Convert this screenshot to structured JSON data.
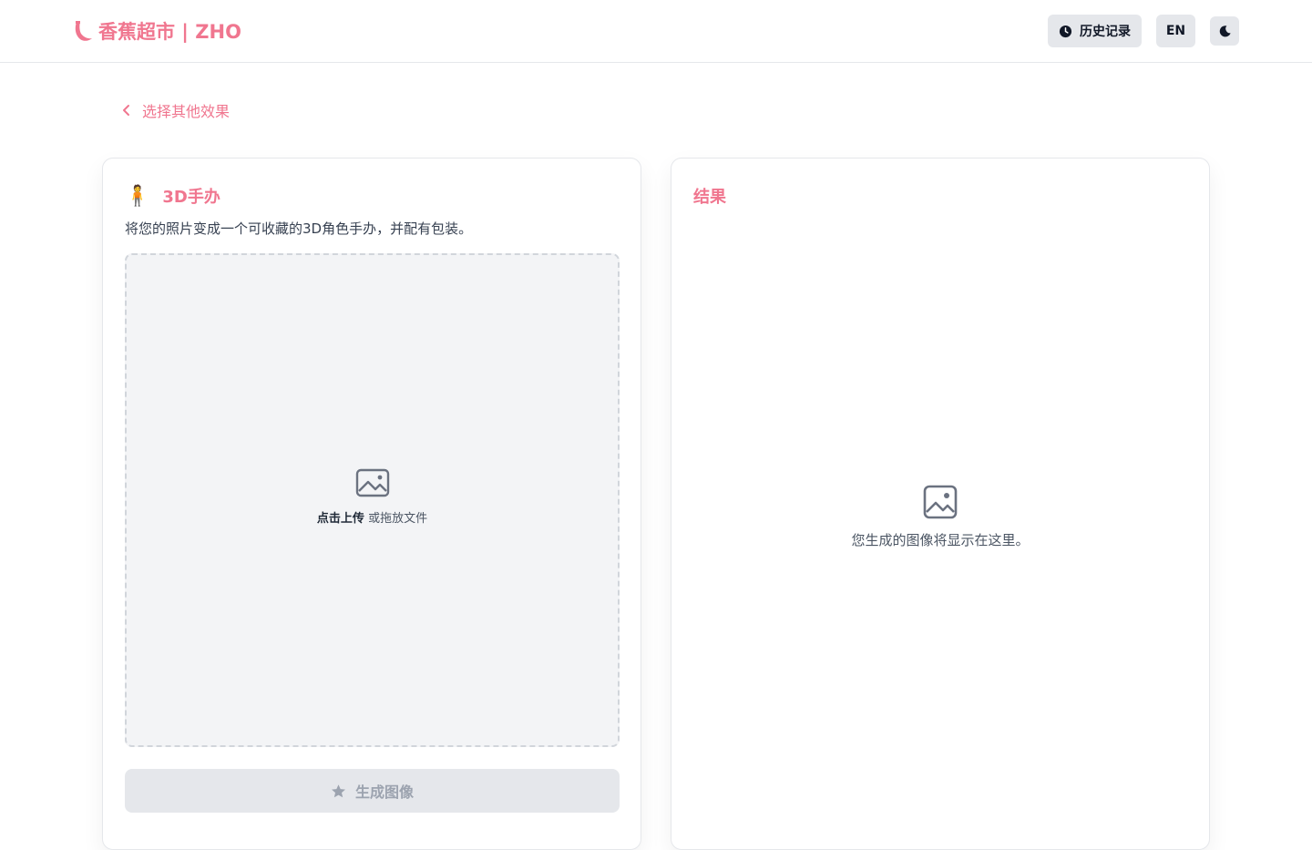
{
  "header": {
    "brand": "香蕉超市 | ZHO",
    "history_label": "历史记录",
    "lang_label": "EN",
    "icons": {
      "brand": "banana-icon",
      "history": "clock-icon",
      "theme": "moon-icon"
    }
  },
  "back": {
    "label": "选择其他效果",
    "icon": "chevron-left-icon"
  },
  "effect": {
    "emoji": "🧍",
    "title": "3D手办",
    "description": "将您的照片变成一个可收藏的3D角色手办，并配有包装。"
  },
  "upload": {
    "click_label": "点击上传",
    "drag_label": "或拖放文件",
    "icon": "image-icon"
  },
  "generate": {
    "label": "生成图像",
    "icon": "star-icon"
  },
  "result": {
    "title": "结果",
    "placeholder": "您生成的图像将显示在这里。",
    "icon": "image-icon"
  },
  "colors": {
    "accent": "#f0768f",
    "disabled": "#9ca3af",
    "muted_bg": "#f3f4f6"
  }
}
